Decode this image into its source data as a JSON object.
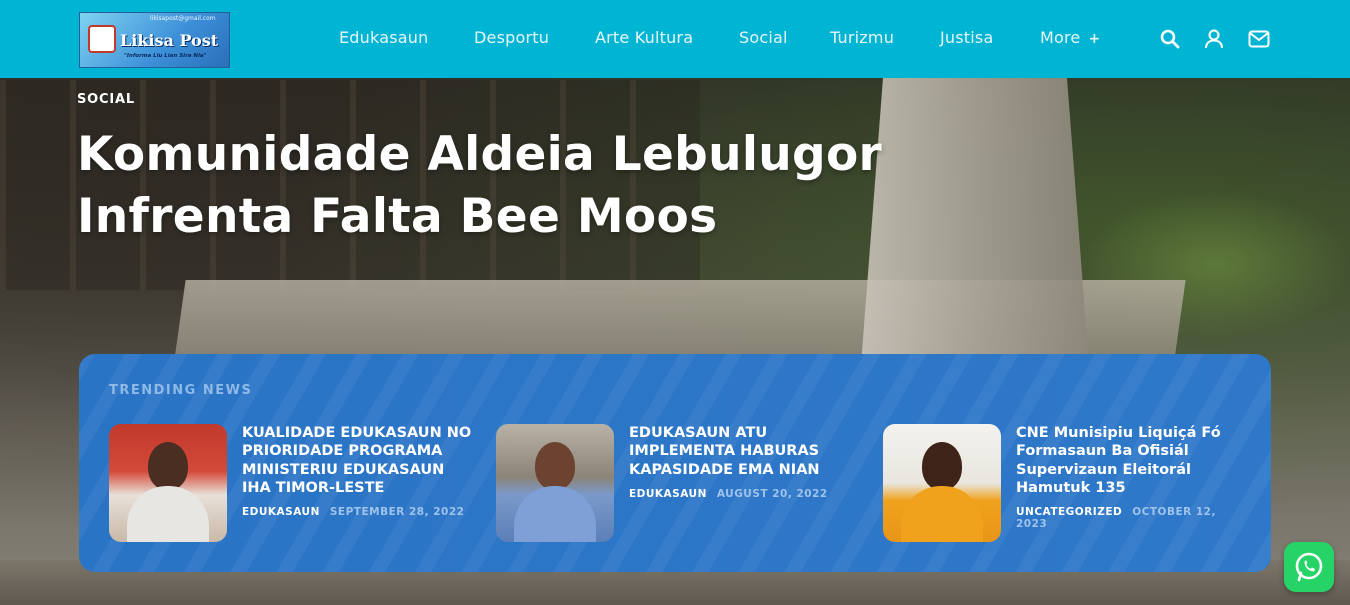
{
  "brand": {
    "logo_title": "Likisa Post",
    "logo_top": "likisapost@gmail.com",
    "logo_tagline": "\"Informa Liu Lian Sira Nia\"",
    "header_color": "#00b4d4"
  },
  "nav": {
    "items": [
      {
        "label": "Edukasaun"
      },
      {
        "label": "Desportu"
      },
      {
        "label": "Arte Kultura"
      },
      {
        "label": "Social"
      },
      {
        "label": "Turizmu"
      },
      {
        "label": "Justisa"
      }
    ],
    "more_label": "More",
    "more_symbol": "+",
    "icons": [
      "search-icon",
      "user-icon",
      "mail-icon"
    ]
  },
  "hero": {
    "category": "SOCIAL",
    "headline": "Komunidade Aldeia Lebulugor Infrenta Falta Bee Moos"
  },
  "trending": {
    "title": "TRENDING NEWS",
    "panel_color": "#2a74c6",
    "items": [
      {
        "headline": "KUALIDADE EDUKASAUN NO PRIORIDADE PROGRAMA MINISTERIU EDUKASAUN IHA TIMOR-LESTE",
        "category": "EDUKASAUN",
        "date": "SEPTEMBER 28, 2022"
      },
      {
        "headline": "EDUKASAUN ATU IMPLEMENTA HABURAS KAPASIDADE EMA NIAN",
        "category": "EDUKASAUN",
        "date": "AUGUST 20, 2022"
      },
      {
        "headline": "CNE Munisipiu Liquiçá Fó Formasaun Ba Ofisiál Supervizaun Eleitorál Hamutuk 135",
        "category": "UNCATEGORIZED",
        "date": "OCTOBER 12, 2023"
      }
    ]
  },
  "floating": {
    "whatsapp_icon": "whatsapp-icon",
    "whatsapp_color": "#25d366"
  }
}
